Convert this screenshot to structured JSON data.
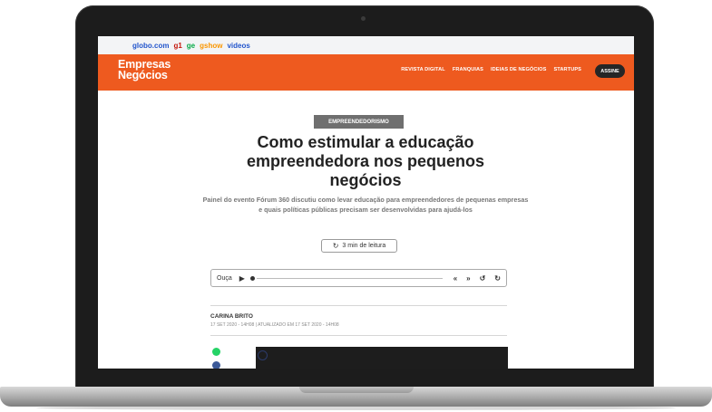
{
  "globo_bar": {
    "globo": "globo.com",
    "g1": "g1",
    "ge": "ge",
    "gshow": "gshow",
    "videos": "videos"
  },
  "header": {
    "logo_line1": "Empresas",
    "logo_line2": "Negócios",
    "nav": [
      "REVISTA DIGITAL",
      "FRANQUIAS",
      "IDEIAS DE NEGÓCIOS",
      "STARTUPS"
    ],
    "subscribe": "ASSINE",
    "brand_color": "#ee5a1f"
  },
  "article": {
    "tag": "EMPREENDEDORISMO",
    "title": "Como estimular a educação empreendedora nos pequenos negócios",
    "subtitle": "Painel do evento Fórum 360 discutiu como levar educação para empreendedores de pequenas empresas e quais políticas públicas precisam ser desenvolvidas para ajudá-los",
    "read_time": "3 min de leitura",
    "author": "CARINA BRITO",
    "date": "17 SET 2020 - 14H08 | ATUALIZADO EM 17 SET 2020 - 14H08"
  },
  "player": {
    "label": "Ouça"
  }
}
